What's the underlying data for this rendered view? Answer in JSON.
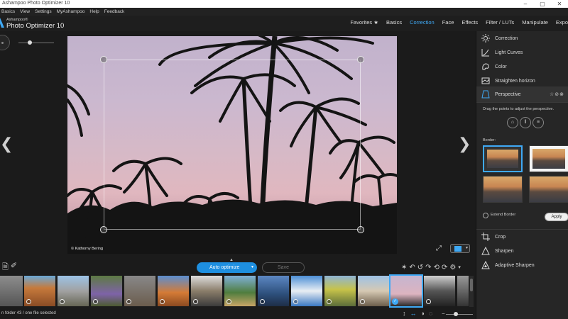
{
  "window": {
    "title": "Ashampoo Photo Optimizer 10",
    "controls": [
      "–",
      "▢",
      "✕"
    ]
  },
  "menu": [
    "Basics",
    "View",
    "Settings",
    "MyAshampoo",
    "Help",
    "Feedback"
  ],
  "brand": {
    "small": "Ashampoo®",
    "big": "Photo Optimizer 10"
  },
  "tabs": [
    {
      "label": "Favorites ★",
      "active": false
    },
    {
      "label": "Basics",
      "active": false
    },
    {
      "label": "Correction",
      "active": true
    },
    {
      "label": "Face",
      "active": false
    },
    {
      "label": "Effects",
      "active": false
    },
    {
      "label": "Filter / LUTs",
      "active": false
    },
    {
      "label": "Manipulate",
      "active": false
    },
    {
      "label": "Expo",
      "active": false
    }
  ],
  "photo": {
    "credit": "© Kathorny Bering"
  },
  "panel": {
    "items_top": [
      {
        "label": "Correction",
        "icon": "sun-icon"
      },
      {
        "label": "Light Curves",
        "icon": "curve-icon"
      },
      {
        "label": "Color",
        "icon": "palette-icon"
      },
      {
        "label": "Straighten horizon",
        "icon": "horizon-icon"
      },
      {
        "label": "Perspective",
        "icon": "perspective-icon"
      }
    ],
    "perspective_actions": "☆⊘⊗",
    "perspective_hint": "Drag the points to adjust the perspective.",
    "border_label": "Border:",
    "extend_border": "Extend Border",
    "apply": "Apply",
    "items_bottom": [
      {
        "label": "Crop",
        "icon": "crop-icon"
      },
      {
        "label": "Sharpen",
        "icon": "sharpen-icon"
      },
      {
        "label": "Adaptive Sharpen",
        "icon": "adaptive-sharpen-icon"
      }
    ]
  },
  "actions": {
    "auto_optimize": "Auto optimize",
    "save": "Save"
  },
  "status": {
    "text": "n folder 43 / one file selected"
  },
  "accent": "#3fa9f5"
}
